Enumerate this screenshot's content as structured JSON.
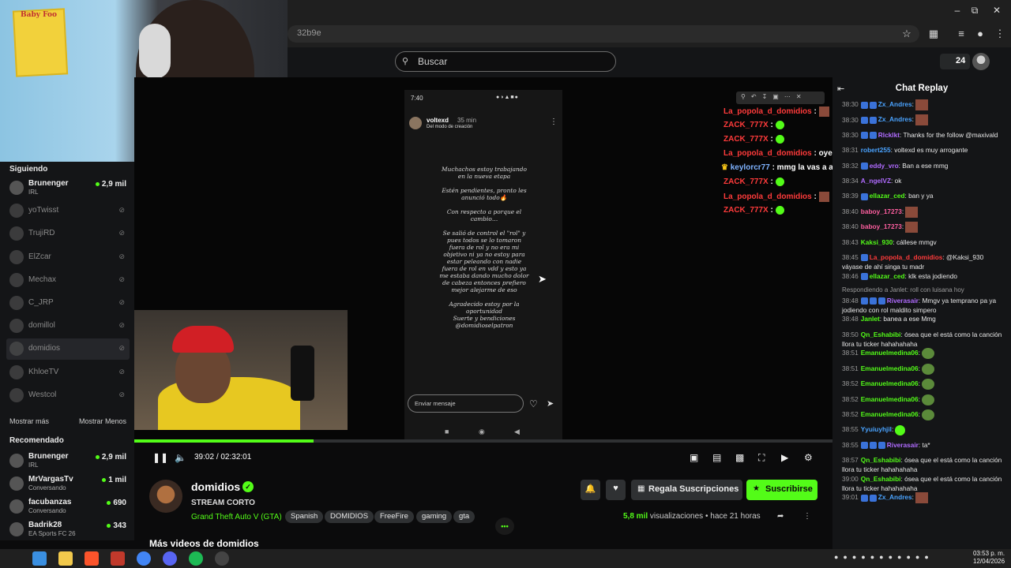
{
  "browser": {
    "url_fragment": "32b9e",
    "window_controls": [
      "minimize-icon",
      "restore-icon",
      "close-icon"
    ],
    "toolbar_icons": [
      "star-icon",
      "extensions-icon",
      "media-icon",
      "profile-icon",
      "menu-icon"
    ]
  },
  "header": {
    "search_placeholder": "Buscar",
    "kick_points": "24"
  },
  "sidebar": {
    "following_title": "Siguiendo",
    "following": [
      {
        "name": "Brunenger",
        "sub": "IRL",
        "viewers": "2,9 mil",
        "live": true
      },
      {
        "name": "yoTwisst",
        "live": false
      },
      {
        "name": "TrujiRD",
        "live": false
      },
      {
        "name": "ElZcar",
        "live": false
      },
      {
        "name": "Mechax",
        "live": false
      },
      {
        "name": "C_JRP",
        "live": false
      },
      {
        "name": "domillol",
        "live": false
      },
      {
        "name": "domidios",
        "live": false,
        "active": true
      },
      {
        "name": "KhloeTV",
        "live": false
      },
      {
        "name": "Westcol",
        "live": false
      }
    ],
    "show_more": "Mostrar más",
    "show_less": "Mostrar Menos",
    "recommended_title": "Recomendado",
    "recommended": [
      {
        "name": "Brunenger",
        "sub": "IRL",
        "viewers": "2,9 mil"
      },
      {
        "name": "MrVargasTv",
        "sub": "Conversando",
        "viewers": "1 mil"
      },
      {
        "name": "facubanzas",
        "sub": "Conversando",
        "viewers": "690"
      },
      {
        "name": "Badrik28",
        "sub": "EA Sports FC 26",
        "viewers": "343"
      }
    ]
  },
  "webcam_poster_text": "Baby Foo",
  "stream": {
    "phone_time": "7:40",
    "story_user": "voltexd",
    "story_time": "35 min",
    "story_sub": "Del modo de creación",
    "story_text": "Muchachos estoy trabajando\nen la nueva etapa\n\nEstén pendientes, pronto les\nanunció todo🔥\n\nCon respecto a porque el\ncambio…\n\nSe salió de control el \"rol\" y\npues todos se lo tomaron\nfuera de rol y no era mi\nobjetivo ni ya no estoy para\nestar peleando con nadie\nfuera de rol en vdd y esto ya\nme estaba dando mucho dolor\nde cabeza entonces prefiero\nmejor alejarme de eso\n\nAgradecido estoy por la\noportunidad\nSuerte y bendiciones\n@domidioselpatron",
    "story_input_placeholder": "Enviar mensaje",
    "overlay_chat": [
      {
        "name": "La_popola_d_domidios",
        "text": ":",
        "emote": "img"
      },
      {
        "name": "ZACK_777X",
        "text": ":",
        "emote": "green"
      },
      {
        "name": "ZACK_777X",
        "text": ":",
        "emote": "green"
      },
      {
        "name": "La_popola_d_domidios",
        "text": ": oye a ese lambon"
      },
      {
        "name": "keylorcr77",
        "text": ": mmg la vas a asustar",
        "crown": true
      },
      {
        "name": "ZACK_777X",
        "text": ":",
        "emote": "green"
      },
      {
        "name": "La_popola_d_domidios",
        "text": ":",
        "emote": "img"
      },
      {
        "name": "ZACK_777X",
        "text": ":",
        "emote": "green"
      }
    ]
  },
  "player": {
    "current_time": "39:02",
    "separator": "/",
    "duration": "02:32:01",
    "progress": 0.257,
    "controls": [
      "pause-icon",
      "volume-icon",
      "clip-icon",
      "theater-icon",
      "pip-icon",
      "fullscreen-icon",
      "speed-icon",
      "settings-icon"
    ]
  },
  "channel": {
    "name": "domidios",
    "verified_mark": "✓",
    "title": "STREAM CORTO",
    "category": "Grand Theft Auto V (GTA)",
    "tags": [
      "Spanish",
      "DOMIDIOS",
      "FreeFire",
      "gaming",
      "gta"
    ],
    "gift_label": "Regala Suscripciones",
    "subscribe_label": "Suscribirse",
    "views": "5,8 mil",
    "views_label": "visualizaciones",
    "dot": "•",
    "ago": "hace 21 horas",
    "more_videos": "Más videos de domidios"
  },
  "chat": {
    "title": "Chat Replay",
    "colors": {
      "name_green": "#53fc18",
      "name_red": "#ff3b3b",
      "name_blue": "#4aa3ff",
      "name_purple": "#b06bff"
    },
    "messages": [
      {
        "ts": "38:30",
        "user": "Zx_Andres",
        "text": ":",
        "color": "#4aa3ff",
        "emote": "img",
        "badges": 2
      },
      {
        "ts": "38:30",
        "user": "Zx_Andres",
        "text": ":",
        "color": "#4aa3ff",
        "emote": "img",
        "badges": 2
      },
      {
        "ts": "38:30",
        "user": "Rlcklkt",
        "text": ": Thanks for the follow @maxivald",
        "color": "#b06bff",
        "badges": 2
      },
      {
        "ts": "38:31",
        "user": "robert255",
        "text": ": voltexd es muy arrogante",
        "color": "#4aa3ff",
        "badges": 0
      },
      {
        "ts": "38:32",
        "user": "eddy_vro",
        "text": ": Ban a ese mmg",
        "color": "#b06bff",
        "badges": 1
      },
      {
        "ts": "38:34",
        "user": "A_ngelVZ",
        "text": ": ok",
        "color": "#b06bff",
        "badges": 0
      },
      {
        "ts": "38:39",
        "user": "ellazar_ced",
        "text": ": ban y ya",
        "color": "#53fc18",
        "badges": 1
      },
      {
        "ts": "38:40",
        "user": "baboy_17273",
        "text": ":",
        "color": "#ff5fa0",
        "emote": "img",
        "badges": 0
      },
      {
        "ts": "38:40",
        "user": "baboy_17273",
        "text": ":",
        "color": "#ff5fa0",
        "emote": "img",
        "badges": 0
      },
      {
        "ts": "38:43",
        "user": "Kaksi_930",
        "text": ": cállese mmgv",
        "color": "#53fc18",
        "badges": 0
      },
      {
        "ts": "38:45",
        "user": "La_popola_d_domidios",
        "text": ": @Kaksi_930 váyase de ahí singa tu madr",
        "color": "#ff3b3b",
        "badges": 1
      },
      {
        "ts": "38:46",
        "user": "ellazar_ced",
        "text": ": klk esta jodiendo",
        "color": "#53fc18",
        "badges": 1
      },
      {
        "reply": "Respondiendo a Janlet: roll con luisana hoy"
      },
      {
        "ts": "38:48",
        "user": "Riverasair",
        "text": ": Mmgv ya temprano pa ya jodiendo con rol maldito simpero",
        "color": "#b06bff",
        "badges": 3
      },
      {
        "ts": "38:48",
        "user": "Janlet",
        "text": ": banea a ese Mmg",
        "color": "#53fc18",
        "badges": 0
      },
      {
        "ts": "38:50",
        "user": "Qn_Eshabibi",
        "text": ": ósea que el está como la canción llora tu ticker hahahahaha",
        "color": "#53fc18",
        "badges": 0
      },
      {
        "ts": "38:51",
        "user": "Emanuelmedina06",
        "text": ":",
        "color": "#53fc18",
        "emote": "frog",
        "badges": 0
      },
      {
        "ts": "38:51",
        "user": "Emanuelmedina06",
        "text": ":",
        "color": "#53fc18",
        "emote": "frog",
        "badges": 0
      },
      {
        "ts": "38:52",
        "user": "Emanuelmedina06",
        "text": ":",
        "color": "#53fc18",
        "emote": "frog",
        "badges": 0
      },
      {
        "ts": "38:52",
        "user": "Emanuelmedina06",
        "text": ":",
        "color": "#53fc18",
        "emote": "frog",
        "badges": 0
      },
      {
        "ts": "38:52",
        "user": "Emanuelmedina06",
        "text": ":",
        "color": "#53fc18",
        "emote": "frog",
        "badges": 0
      },
      {
        "ts": "38:55",
        "user": "Yyuiuyhjil",
        "text": ":",
        "color": "#4aa3ff",
        "emote": "green",
        "badges": 0
      },
      {
        "ts": "38:55",
        "user": "Riverasair",
        "text": ": ta*",
        "color": "#b06bff",
        "badges": 3
      },
      {
        "ts": "38:57",
        "user": "Qn_Eshabibi",
        "text": ": ósea que el está como la canción llora tu ticker hahahahaha",
        "color": "#53fc18",
        "badges": 0
      },
      {
        "ts": "39:00",
        "user": "Qn_Eshabibi",
        "text": ": ósea que el está como la canción llora tu ticker hahahahaha",
        "color": "#53fc18",
        "badges": 0
      },
      {
        "ts": "39:01",
        "user": "Zx_Andres",
        "text": ":",
        "color": "#4aa3ff",
        "emote": "img",
        "badges": 2
      }
    ]
  },
  "taskbar": {
    "apps": [
      "windows-icon",
      "explorer-icon",
      "brave-icon",
      "app-icon",
      "chrome-icon",
      "discord-icon",
      "spotify-icon",
      "obs-icon"
    ],
    "time": "03:53 p. m.",
    "date": "12/04/2026"
  }
}
